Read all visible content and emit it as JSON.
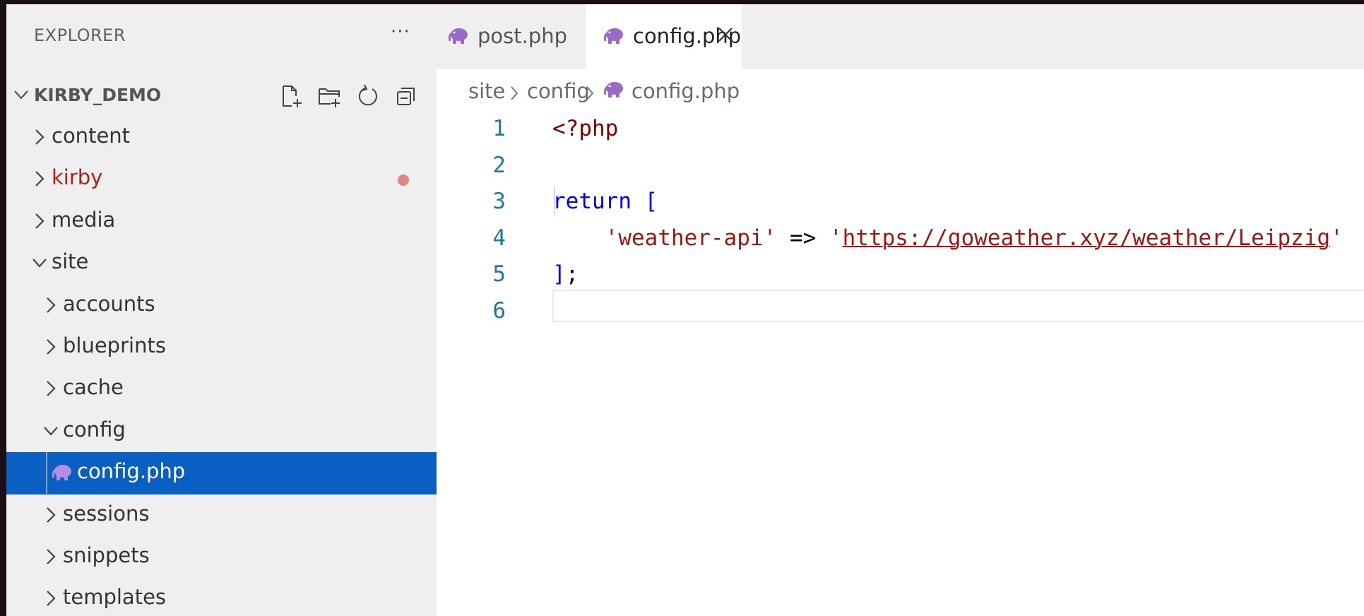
{
  "colors": {
    "accent_selection": "#0a60c2",
    "modified_text": "#b01f1f",
    "modified_dot": "#dd8787",
    "php_icon": "#9a6bc4"
  },
  "explorer": {
    "title": "EXPLORER",
    "more_label": "···",
    "root": {
      "label": "KIRBY_DEMO",
      "actions": [
        "new-file-icon",
        "new-folder-icon",
        "refresh-icon",
        "collapse-all-icon"
      ]
    },
    "tree": [
      {
        "label": "content",
        "type": "folder",
        "expanded": false,
        "depth": 0
      },
      {
        "label": "kirby",
        "type": "folder",
        "expanded": false,
        "depth": 0,
        "modified": true
      },
      {
        "label": "media",
        "type": "folder",
        "expanded": false,
        "depth": 0
      },
      {
        "label": "site",
        "type": "folder",
        "expanded": true,
        "depth": 0
      },
      {
        "label": "accounts",
        "type": "folder",
        "expanded": false,
        "depth": 1
      },
      {
        "label": "blueprints",
        "type": "folder",
        "expanded": false,
        "depth": 1
      },
      {
        "label": "cache",
        "type": "folder",
        "expanded": false,
        "depth": 1
      },
      {
        "label": "config",
        "type": "folder",
        "expanded": true,
        "depth": 1
      },
      {
        "label": "config.php",
        "type": "file",
        "depth": 2,
        "selected": true,
        "icon": "php-elephant-icon"
      },
      {
        "label": "sessions",
        "type": "folder",
        "expanded": false,
        "depth": 1
      },
      {
        "label": "snippets",
        "type": "folder",
        "expanded": false,
        "depth": 1
      },
      {
        "label": "templates",
        "type": "folder",
        "expanded": false,
        "depth": 1
      }
    ]
  },
  "tabs": [
    {
      "label": "post.php",
      "active": false,
      "icon": "php-elephant-icon"
    },
    {
      "label": "config.php",
      "active": true,
      "icon": "php-elephant-icon",
      "close_icon": "close-icon"
    }
  ],
  "breadcrumb": [
    "site",
    "config",
    "config.php"
  ],
  "editor": {
    "line_numbers": [
      "1",
      "2",
      "3",
      "4",
      "5",
      "6"
    ],
    "lines": [
      [
        {
          "t": "<?php",
          "c": "tag"
        }
      ],
      [],
      [
        {
          "t": "return",
          "c": "kw"
        },
        {
          "t": " [",
          "c": "kw"
        }
      ],
      [
        {
          "t": "    'weather-api'",
          "c": "str"
        },
        {
          "t": " => ",
          "c": "op"
        },
        {
          "t": "'",
          "c": "str"
        },
        {
          "t": "https://goweather.xyz/weather/Leipzig",
          "c": "str url"
        },
        {
          "t": "'",
          "c": "str"
        }
      ],
      [
        {
          "t": "]",
          "c": "kw"
        },
        {
          "t": ";",
          "c": "op"
        }
      ],
      []
    ],
    "current_line": "6"
  }
}
